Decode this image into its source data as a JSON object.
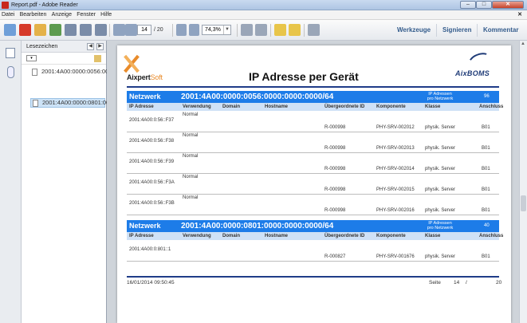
{
  "window": {
    "title": "Report.pdf - Adobe Reader"
  },
  "menu": [
    "Datei",
    "Bearbeiten",
    "Anzeige",
    "Fenster",
    "Hilfe"
  ],
  "toolbar": {
    "current_page": "14",
    "total_pages": "/ 20",
    "zoom": "74,3%",
    "werkzeuge": "Werkzeuge",
    "signieren": "Signieren",
    "kommentar": "Kommentar"
  },
  "bookmarks": {
    "title": "Lesezeichen",
    "items": [
      {
        "label": "2001:4A00:0000:0056:0000:0000:0000/64",
        "selected": false
      },
      {
        "label": "2001:4A00:0000:0801:0000:0000:0000/64",
        "selected": true
      }
    ]
  },
  "report": {
    "logo_left_main": "Aixpert",
    "logo_left_soft": "Soft",
    "title": "IP Adresse per Gerät",
    "logo_right": "AixBOMS",
    "columns": [
      "IP Adresse",
      "Verwendung",
      "Domain",
      "Hostname",
      "Übergeordnete ID",
      "Komponente",
      "Klasse",
      "Anschluss"
    ],
    "networks": [
      {
        "label": "Netzwerk",
        "address": "2001:4A00:0000:0056:0000:0000:0000/64",
        "count_label": "IP Adressen pro Netzwerk",
        "count": "96",
        "rows": [
          {
            "ip": "2001:4A00:0:56::F37",
            "use": "Normal",
            "parent": "R-000998",
            "comp": "PHY-SRV-002012",
            "klass": "physik. Server",
            "port": "B01"
          },
          {
            "ip": "2001:4A00:0:56::F38",
            "use": "Normal",
            "parent": "R-000998",
            "comp": "PHY-SRV-002013",
            "klass": "physik. Server",
            "port": "B01"
          },
          {
            "ip": "2001:4A00:0:56::F39",
            "use": "Normal",
            "parent": "R-000998",
            "comp": "PHY-SRV-002014",
            "klass": "physik. Server",
            "port": "B01"
          },
          {
            "ip": "2001:4A00:0:56::F3A",
            "use": "Normal",
            "parent": "R-000998",
            "comp": "PHY-SRV-002015",
            "klass": "physik. Server",
            "port": "B01"
          },
          {
            "ip": "2001:4A00:0:56::F3B",
            "use": "Normal",
            "parent": "R-000998",
            "comp": "PHY-SRV-002016",
            "klass": "physik. Server",
            "port": "B01"
          }
        ]
      },
      {
        "label": "Netzwerk",
        "address": "2001:4A00:0000:0801:0000:0000:0000/64",
        "count_label": "IP Adressen pro Netzwerk",
        "count": "40",
        "rows": [
          {
            "ip": "2001:4A00:0:801::1",
            "use": "",
            "parent": "R-000827",
            "comp": "PHY-SRV-001676",
            "klass": "physik. Server",
            "port": "B01"
          }
        ]
      }
    ],
    "footer": {
      "date": "16/01/2014 09:50:45",
      "seite_label": "Seite",
      "page": "14",
      "slash": "/",
      "total": "20"
    }
  }
}
